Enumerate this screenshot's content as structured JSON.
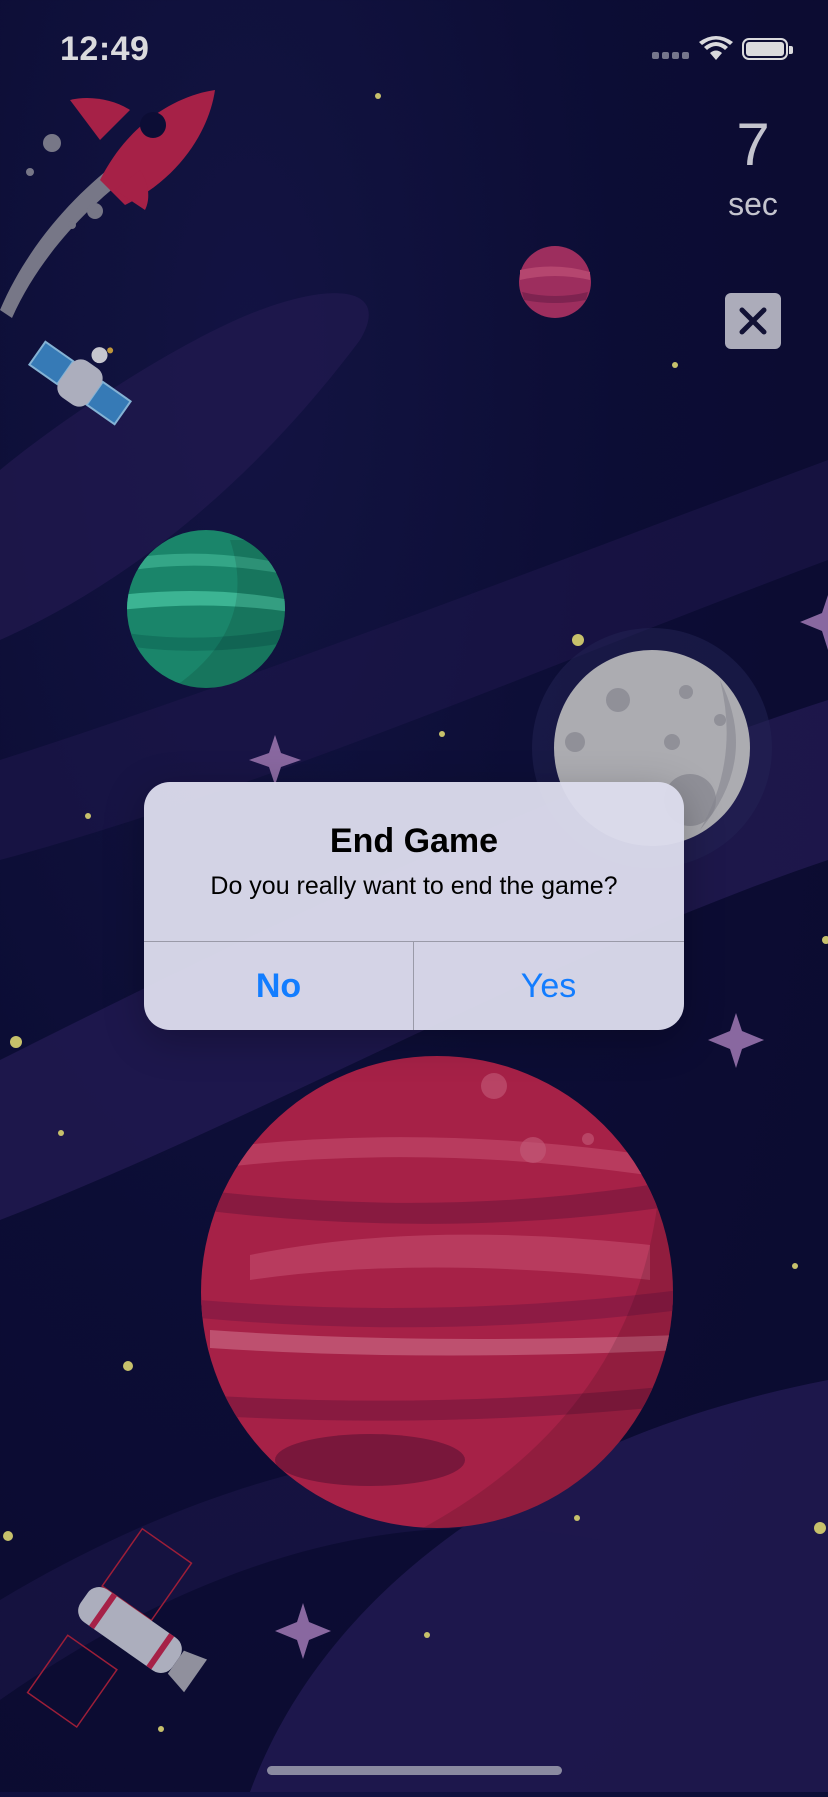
{
  "status_bar": {
    "time": "12:49"
  },
  "timer": {
    "value": "7",
    "unit": "sec"
  },
  "close_button": {
    "icon": "close-icon"
  },
  "alert": {
    "title": "End Game",
    "message": "Do you really want to end the game?",
    "buttons": {
      "no": "No",
      "yes": "Yes"
    },
    "accent_color": "#137dff"
  },
  "colors": {
    "background": "#0e0f3a",
    "planet_red": "#c2264f",
    "planet_green": "#1e9c78",
    "moon": "#c9c9cc"
  }
}
